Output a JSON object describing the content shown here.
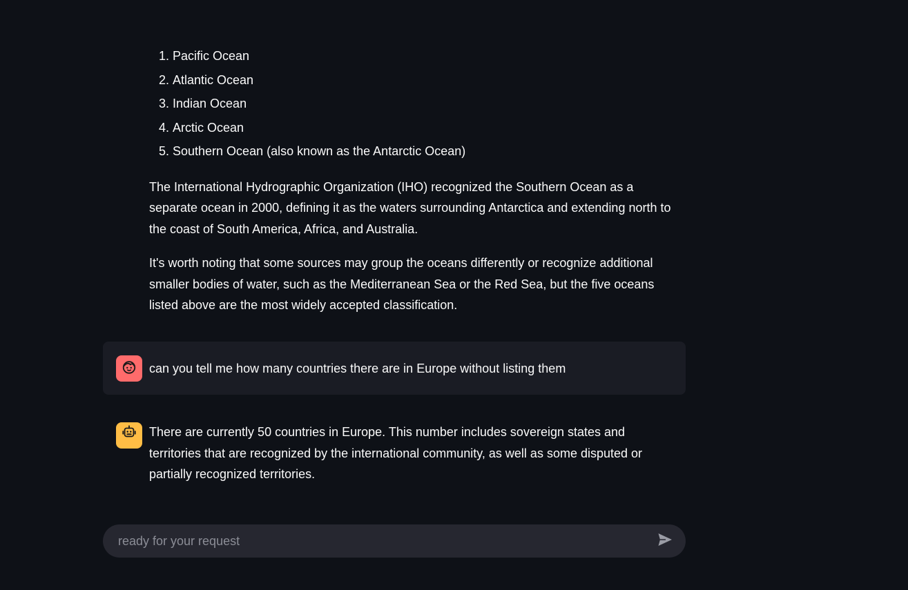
{
  "conversation": {
    "assistant_1": {
      "oceans": [
        {
          "num": "1.",
          "text": "Pacific Ocean"
        },
        {
          "num": "2.",
          "text": "Atlantic Ocean"
        },
        {
          "num": "3.",
          "text": "Indian Ocean"
        },
        {
          "num": "4.",
          "text": "Arctic Ocean"
        },
        {
          "num": "5.",
          "text": "Southern Ocean (also known as the Antarctic Ocean)"
        }
      ],
      "paragraph_1": "The International Hydrographic Organization (IHO) recognized the Southern Ocean as a separate ocean in 2000, defining it as the waters surrounding Antarctica and extending north to the coast of South America, Africa, and Australia.",
      "paragraph_2": "It's worth noting that some sources may group the oceans differently or recognize additional smaller bodies of water, such as the Mediterranean Sea or the Red Sea, but the five oceans listed above are the most widely accepted classification."
    },
    "user_1": {
      "text": "can you tell me how many countries there are in Europe without listing them",
      "avatar_icon": "user-face-icon",
      "avatar_color": "#ff6b6b"
    },
    "assistant_2": {
      "text": "There are currently 50 countries in Europe. This number includes sovereign states and territories that are recognized by the international community, as well as some disputed or partially recognized territories.",
      "avatar_icon": "robot-icon",
      "avatar_color": "#ffbd45"
    }
  },
  "chat_input": {
    "placeholder": "ready for your request",
    "value": "",
    "send_icon": "send-icon"
  },
  "colors": {
    "background": "#0e1117",
    "user_bubble": "#1a1c24",
    "input_background": "#262730",
    "text": "#fafafa"
  }
}
